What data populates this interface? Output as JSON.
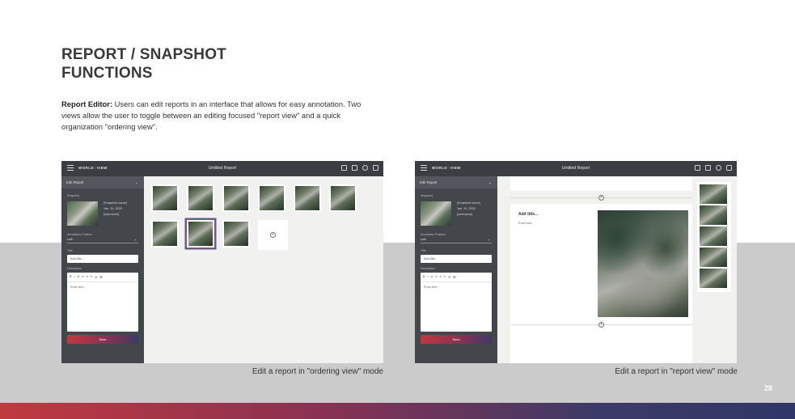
{
  "title": {
    "line1": "REPORT / SNAPSHOT",
    "line2": "FUNCTIONS"
  },
  "intro": {
    "bold": "Report Editor:",
    "text": " Users can edit reports in an interface that allows for easy annotation. Two views allow the user to toggle between an editing focused \"report view\" and a quick organization \"ordering view\"."
  },
  "app": {
    "logo_left": "WORLD",
    "logo_right": "VIEW",
    "doc_title": "Untitled Report",
    "sidebar": {
      "header": "Edit Report",
      "snapshot_label": "Snapshot",
      "snapshot_name": "[Snapshot name]",
      "snapshot_date": "Jan. 31, 2020",
      "snapshot_user": "[username]",
      "annotation_label": "Annotation Position",
      "annotation_value": "Left",
      "title_label": "Title",
      "title_placeholder": "Add title...",
      "description_label": "Description",
      "toolbar": [
        "B",
        "I",
        "U",
        "≡",
        "≡",
        "≡",
        "⊖",
        "⊞"
      ],
      "editor_placeholder": "Enter text...",
      "save_label": "Save"
    },
    "report_view": {
      "card_title": "Add title...",
      "card_text": "Enter text..."
    }
  },
  "captions": {
    "left": "Edit a report in \"ordering view\" mode",
    "right": "Edit a report in \"report view\" mode"
  },
  "page_number": "28",
  "colors": {
    "brand_red": "#c0393f",
    "brand_navy": "#2f3766",
    "topbar": "#3a3d42",
    "sidebar": "#43474c"
  }
}
